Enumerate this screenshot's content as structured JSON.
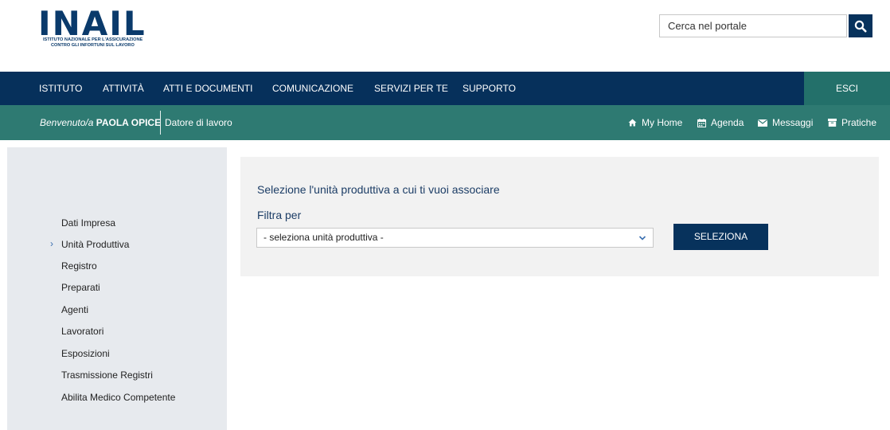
{
  "logo": {
    "wordmark": "INAIL",
    "subtitle_line1": "ISTITUTO NAZIONALE PER L'ASSICURAZIONE",
    "subtitle_line2": "CONTRO GLI INFORTUNI SUL LAVORO"
  },
  "search": {
    "placeholder": "Cerca nel portale",
    "button_icon": "search-icon"
  },
  "mainnav": {
    "items": [
      "ISTITUTO",
      "ATTIVITÀ",
      "ATTI E DOCUMENTI",
      "COMUNICAZIONE",
      "SERVIZI PER TE",
      "SUPPORTO"
    ],
    "logout_label": "ESCI"
  },
  "userbar": {
    "welcome_prefix": "Benvenuto/a",
    "user_name": "PAOLA OPICE",
    "role": "Datore di lavoro",
    "links": [
      {
        "label": "My Home",
        "icon": "home-icon"
      },
      {
        "label": "Agenda",
        "icon": "calendar-icon"
      },
      {
        "label": "Messaggi",
        "icon": "envelope-icon"
      },
      {
        "label": "Pratiche",
        "icon": "folder-icon"
      }
    ]
  },
  "sidebar": {
    "active_marker": "›",
    "items": [
      "Dati Impresa",
      "Unità Produttiva",
      "Registro",
      "Preparati",
      "Agenti",
      "Lavoratori",
      "Esposizioni",
      "Trasmissione Registri",
      "Abilita Medico Competente"
    ],
    "active_index": 1
  },
  "main": {
    "title": "Selezione l'unità produttiva a cui ti vuoi associare",
    "filter_label": "Filtra per",
    "select_value": "- seleziona unità produttiva -",
    "submit_label": "SELEZIONA"
  },
  "colors": {
    "navy": "#06305b",
    "teal": "#2e7a72",
    "esci_bg": "#23706a",
    "sidebar_bg": "#e7eaee",
    "panel_bg": "#f2f2f2",
    "heading": "#1c3d66"
  }
}
